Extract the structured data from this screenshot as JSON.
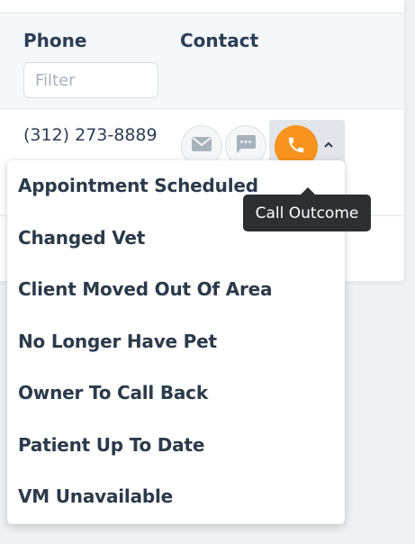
{
  "table": {
    "columns": {
      "phone": "Phone",
      "contact": "Contact"
    },
    "filter": {
      "placeholder": "Filter",
      "value": ""
    },
    "row": {
      "phone": "(312) 273-8889"
    }
  },
  "actions": {
    "email_icon": "envelope-icon",
    "sms_icon": "message-icon",
    "call_icon": "phone-icon",
    "caret_icon": "chevron-up-icon"
  },
  "tooltip": {
    "text": "Call Outcome"
  },
  "dropdown": {
    "items": [
      {
        "label": "Appointment Scheduled"
      },
      {
        "label": "Changed Vet"
      },
      {
        "label": "Client Moved Out Of Area"
      },
      {
        "label": "No Longer Have Pet"
      },
      {
        "label": "Owner To Call Back"
      },
      {
        "label": "Patient Up To Date"
      },
      {
        "label": "VM Unavailable"
      }
    ]
  },
  "colors": {
    "call_accent": "#f7931e",
    "tooltip_bg": "#2d2f33",
    "header_bg": "#f5f8fb"
  }
}
